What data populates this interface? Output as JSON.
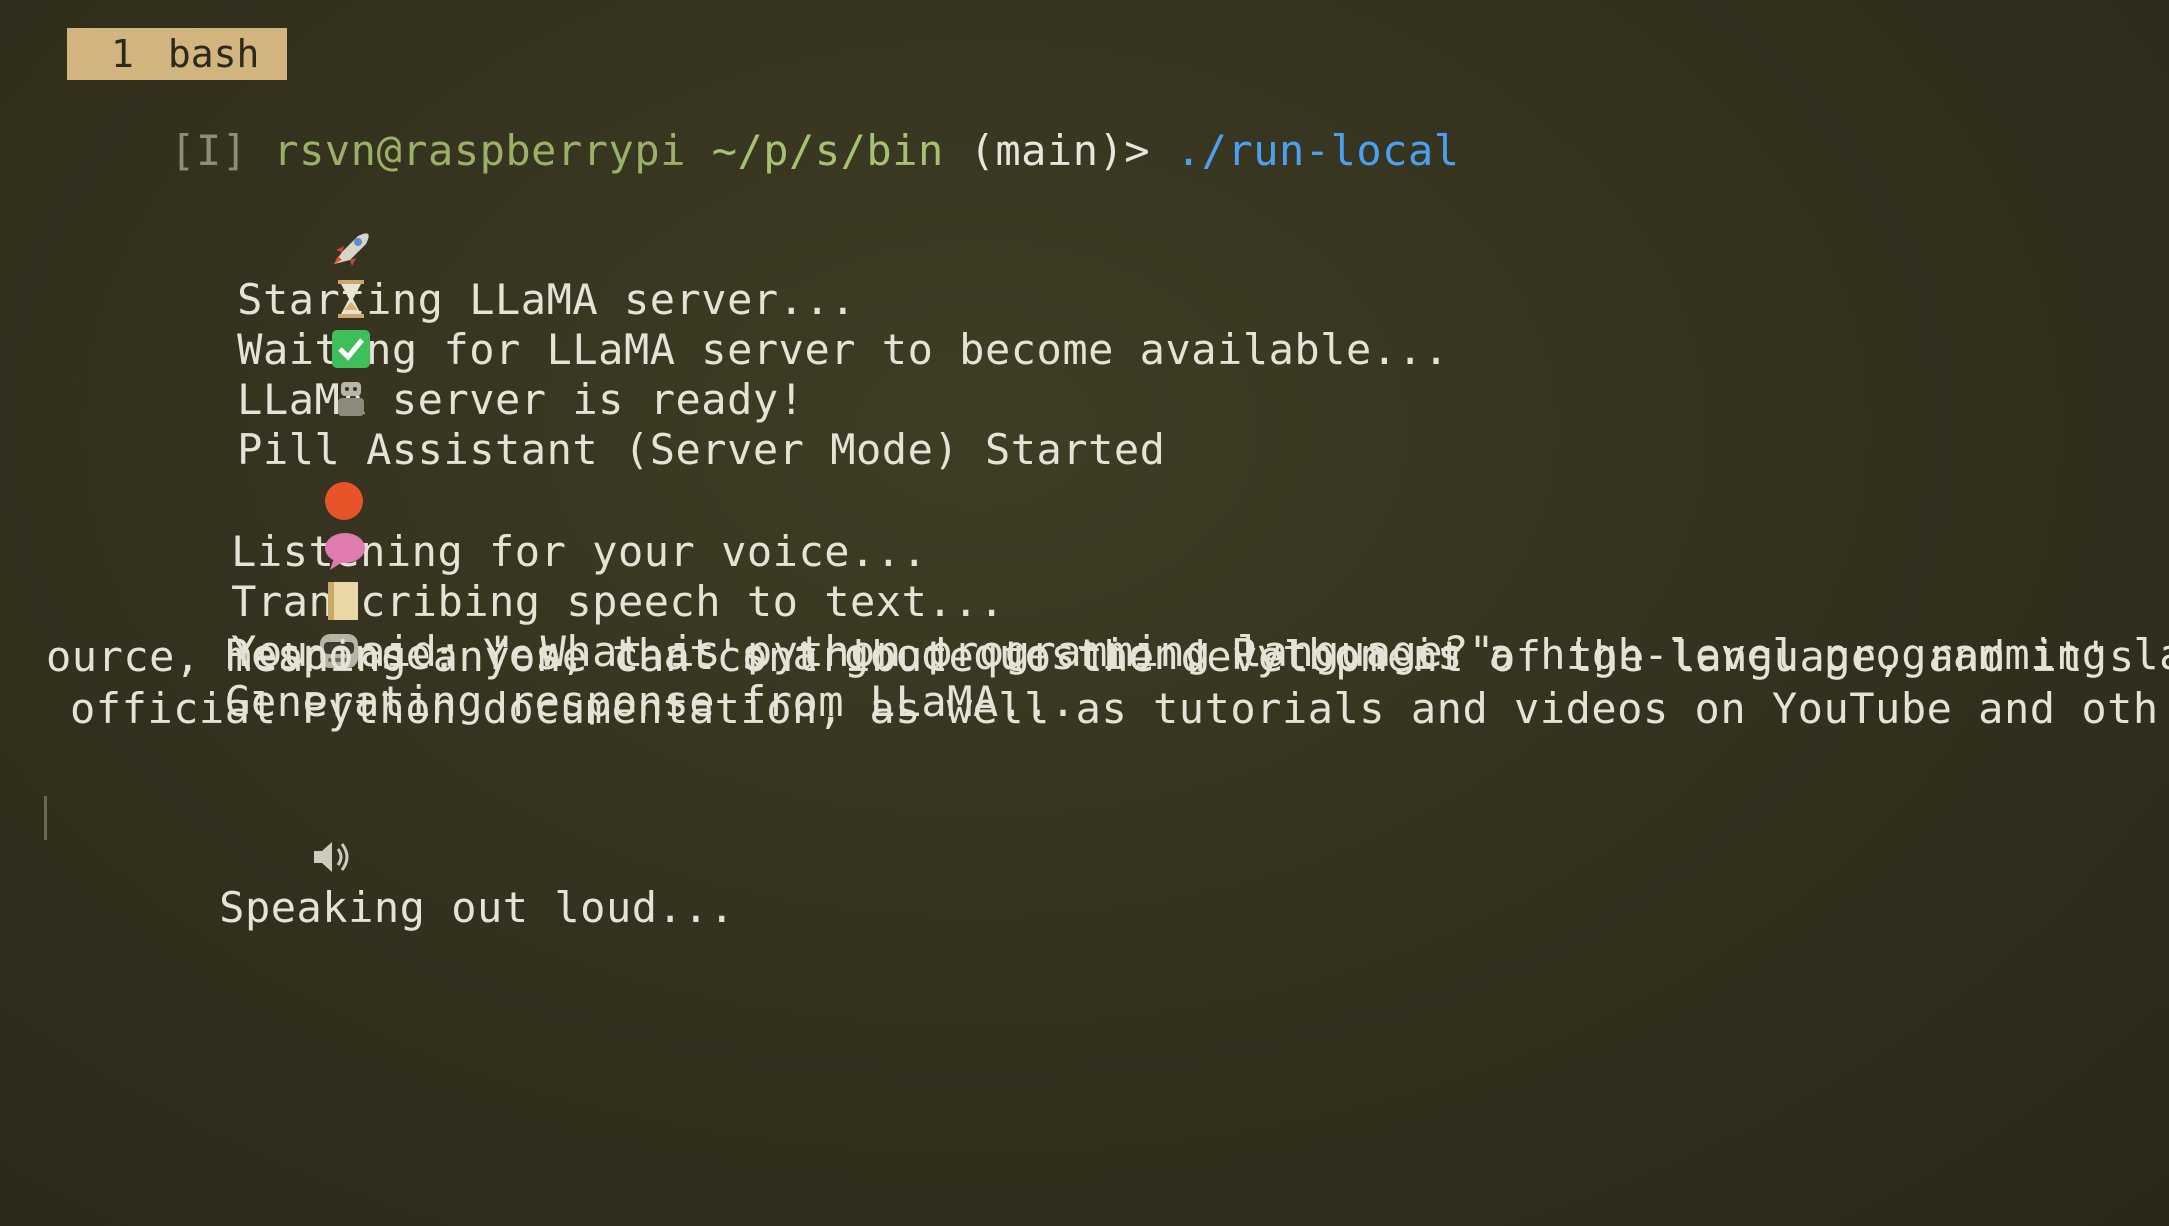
{
  "tab": {
    "number": "1",
    "title": "bash"
  },
  "prompt": {
    "mode": "[I]",
    "user_host": "rsvn@raspberrypi",
    "path": "~/p/s/bin",
    "branch": "(main)>",
    "command": "./run-local"
  },
  "output": {
    "starting": "Starting LLaMA server...",
    "waiting": "Waiting for LLaMA server to become available...",
    "ready": "LLaMA server is ready!",
    "started": "Pill Assistant (Server Mode) Started",
    "listening": "Listening for your voice...",
    "transcribing": "Transcribing speech to text...",
    "you_said": "You said: \" What is python programming language?\"",
    "generating": "Generating response from LLaMA...",
    "response_1": "Response: Yes, that's a good question. Python is a high-level programming langu",
    "response_2": "ource, meaning anyone can contribute to the development of the language, and it's",
    "response_3": "official Python documentation, as well as tutorials and videos on YouTube and oth",
    "speaking": "Speaking out loud..."
  },
  "icons": {
    "starting": "rocket-icon",
    "waiting": "hourglass-icon",
    "ready": "check-mark-icon",
    "started": "robot-icon",
    "listening": "red-circle-icon",
    "transcribing": "speech-bubble-icon",
    "you_said": "memo-icon",
    "generating": "robot-face-icon",
    "response": "blank-icon",
    "speaking": "speaker-icon"
  },
  "colors": {
    "background": "#35331f",
    "foreground": "#e6e3d6",
    "tab_background": "#d2b47f",
    "prompt_user": "#9bb067",
    "command": "#4aa1f2",
    "ready_check": "#3fbf5a",
    "listening_dot": "#e8542a",
    "bubble": "#e07bb0"
  }
}
